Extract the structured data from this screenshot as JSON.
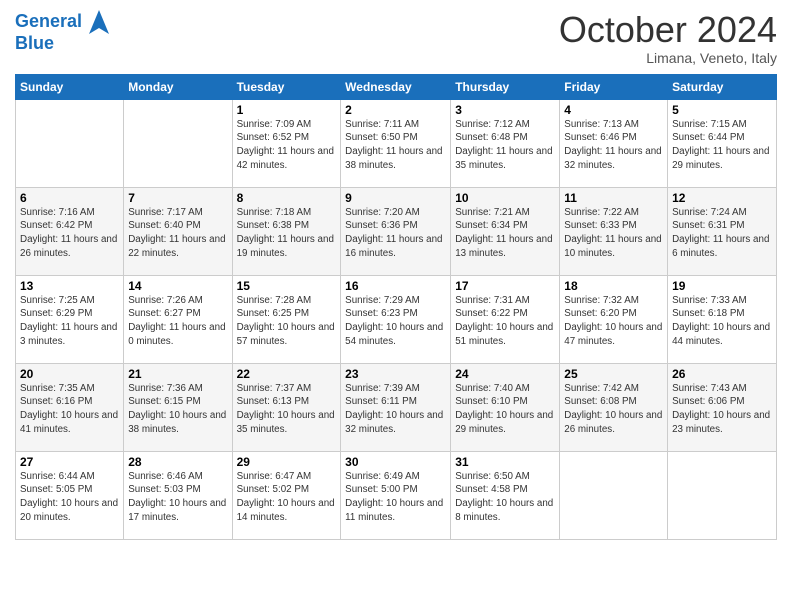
{
  "header": {
    "logo_line1": "General",
    "logo_line2": "Blue",
    "month_title": "October 2024",
    "location": "Limana, Veneto, Italy"
  },
  "days_of_week": [
    "Sunday",
    "Monday",
    "Tuesday",
    "Wednesday",
    "Thursday",
    "Friday",
    "Saturday"
  ],
  "weeks": [
    [
      {
        "day": "",
        "info": ""
      },
      {
        "day": "",
        "info": ""
      },
      {
        "day": "1",
        "info": "Sunrise: 7:09 AM\nSunset: 6:52 PM\nDaylight: 11 hours and 42 minutes."
      },
      {
        "day": "2",
        "info": "Sunrise: 7:11 AM\nSunset: 6:50 PM\nDaylight: 11 hours and 38 minutes."
      },
      {
        "day": "3",
        "info": "Sunrise: 7:12 AM\nSunset: 6:48 PM\nDaylight: 11 hours and 35 minutes."
      },
      {
        "day": "4",
        "info": "Sunrise: 7:13 AM\nSunset: 6:46 PM\nDaylight: 11 hours and 32 minutes."
      },
      {
        "day": "5",
        "info": "Sunrise: 7:15 AM\nSunset: 6:44 PM\nDaylight: 11 hours and 29 minutes."
      }
    ],
    [
      {
        "day": "6",
        "info": "Sunrise: 7:16 AM\nSunset: 6:42 PM\nDaylight: 11 hours and 26 minutes."
      },
      {
        "day": "7",
        "info": "Sunrise: 7:17 AM\nSunset: 6:40 PM\nDaylight: 11 hours and 22 minutes."
      },
      {
        "day": "8",
        "info": "Sunrise: 7:18 AM\nSunset: 6:38 PM\nDaylight: 11 hours and 19 minutes."
      },
      {
        "day": "9",
        "info": "Sunrise: 7:20 AM\nSunset: 6:36 PM\nDaylight: 11 hours and 16 minutes."
      },
      {
        "day": "10",
        "info": "Sunrise: 7:21 AM\nSunset: 6:34 PM\nDaylight: 11 hours and 13 minutes."
      },
      {
        "day": "11",
        "info": "Sunrise: 7:22 AM\nSunset: 6:33 PM\nDaylight: 11 hours and 10 minutes."
      },
      {
        "day": "12",
        "info": "Sunrise: 7:24 AM\nSunset: 6:31 PM\nDaylight: 11 hours and 6 minutes."
      }
    ],
    [
      {
        "day": "13",
        "info": "Sunrise: 7:25 AM\nSunset: 6:29 PM\nDaylight: 11 hours and 3 minutes."
      },
      {
        "day": "14",
        "info": "Sunrise: 7:26 AM\nSunset: 6:27 PM\nDaylight: 11 hours and 0 minutes."
      },
      {
        "day": "15",
        "info": "Sunrise: 7:28 AM\nSunset: 6:25 PM\nDaylight: 10 hours and 57 minutes."
      },
      {
        "day": "16",
        "info": "Sunrise: 7:29 AM\nSunset: 6:23 PM\nDaylight: 10 hours and 54 minutes."
      },
      {
        "day": "17",
        "info": "Sunrise: 7:31 AM\nSunset: 6:22 PM\nDaylight: 10 hours and 51 minutes."
      },
      {
        "day": "18",
        "info": "Sunrise: 7:32 AM\nSunset: 6:20 PM\nDaylight: 10 hours and 47 minutes."
      },
      {
        "day": "19",
        "info": "Sunrise: 7:33 AM\nSunset: 6:18 PM\nDaylight: 10 hours and 44 minutes."
      }
    ],
    [
      {
        "day": "20",
        "info": "Sunrise: 7:35 AM\nSunset: 6:16 PM\nDaylight: 10 hours and 41 minutes."
      },
      {
        "day": "21",
        "info": "Sunrise: 7:36 AM\nSunset: 6:15 PM\nDaylight: 10 hours and 38 minutes."
      },
      {
        "day": "22",
        "info": "Sunrise: 7:37 AM\nSunset: 6:13 PM\nDaylight: 10 hours and 35 minutes."
      },
      {
        "day": "23",
        "info": "Sunrise: 7:39 AM\nSunset: 6:11 PM\nDaylight: 10 hours and 32 minutes."
      },
      {
        "day": "24",
        "info": "Sunrise: 7:40 AM\nSunset: 6:10 PM\nDaylight: 10 hours and 29 minutes."
      },
      {
        "day": "25",
        "info": "Sunrise: 7:42 AM\nSunset: 6:08 PM\nDaylight: 10 hours and 26 minutes."
      },
      {
        "day": "26",
        "info": "Sunrise: 7:43 AM\nSunset: 6:06 PM\nDaylight: 10 hours and 23 minutes."
      }
    ],
    [
      {
        "day": "27",
        "info": "Sunrise: 6:44 AM\nSunset: 5:05 PM\nDaylight: 10 hours and 20 minutes."
      },
      {
        "day": "28",
        "info": "Sunrise: 6:46 AM\nSunset: 5:03 PM\nDaylight: 10 hours and 17 minutes."
      },
      {
        "day": "29",
        "info": "Sunrise: 6:47 AM\nSunset: 5:02 PM\nDaylight: 10 hours and 14 minutes."
      },
      {
        "day": "30",
        "info": "Sunrise: 6:49 AM\nSunset: 5:00 PM\nDaylight: 10 hours and 11 minutes."
      },
      {
        "day": "31",
        "info": "Sunrise: 6:50 AM\nSunset: 4:58 PM\nDaylight: 10 hours and 8 minutes."
      },
      {
        "day": "",
        "info": ""
      },
      {
        "day": "",
        "info": ""
      }
    ]
  ]
}
